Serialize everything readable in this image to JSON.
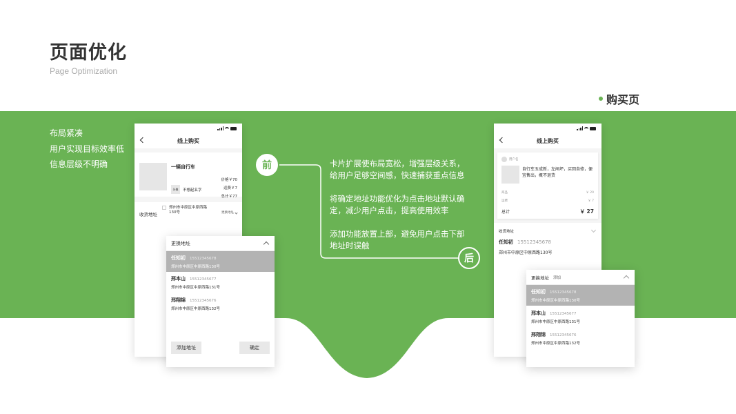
{
  "header": {
    "title": "页面优化",
    "subtitle": "Page Optimization",
    "section": "购买页"
  },
  "colors": {
    "accent": "#6ab354",
    "selected_row": "#b3b3b3",
    "button_bg": "#e8e8e8"
  },
  "problems": [
    "布局紧凑",
    "用户实现目标效率低",
    "信息层级不明确"
  ],
  "before": {
    "badge": "前",
    "nav_title": "线上购买",
    "product": {
      "name": "一辆自行车",
      "price": "价格￥70",
      "shipping": "运费￥7",
      "total": "总计￥77",
      "seller_avatar": "头像",
      "seller_name": "不想起名字"
    },
    "address_row": {
      "label": "收货地址",
      "value": "郑州市中原区中原西路130号",
      "change": "更换地址"
    },
    "popup": {
      "title": "更换地址",
      "items": [
        {
          "name": "任知初",
          "phone": "15512345678",
          "address": "郑州市中原区中原西路130号",
          "selected": true
        },
        {
          "name": "邢本山",
          "phone": "15512345677",
          "address": "郑州市中原区中原西路131号",
          "selected": false
        },
        {
          "name": "邢翔锦",
          "phone": "15512345676",
          "address": "郑州市中原区中原西路132号",
          "selected": false
        }
      ],
      "add_button": "添加地址",
      "confirm_button": "确定"
    }
  },
  "after": {
    "badge": "后",
    "nav_title": "线上购买",
    "card": {
      "username": "用户名",
      "description": "自行车五成新，左闸坏，买回自修，便宜售出，概不退货",
      "goods_label": "商品",
      "goods_value": "￥ 20",
      "shipping_label": "运费",
      "shipping_value": "￥ 7",
      "total_label": "总计",
      "total_value": "￥ 27"
    },
    "address": {
      "label": "收货地址",
      "name": "任知初",
      "phone": "15512345678",
      "value": "郑州市中原区中原西路130号"
    },
    "popup": {
      "title": "更换地址",
      "add": "添加",
      "items": [
        {
          "name": "任知初",
          "phone": "15512345678",
          "address": "郑州市中原区中原西路130号",
          "selected": true
        },
        {
          "name": "邢本山",
          "phone": "15512345677",
          "address": "郑州市中原区中原西路131号",
          "selected": false
        },
        {
          "name": "邢翔锦",
          "phone": "15512345676",
          "address": "郑州市中原区中原西路132号",
          "selected": false
        }
      ]
    }
  },
  "notes": [
    "卡片扩展使布局宽松，增强层级关系，给用户足够空间感，快速捕获重点信息",
    "将确定地址功能优化为点击地址默认确定，减少用户点击，提高使用效率",
    "添加功能放置上部，避免用户点击下部地址时误触"
  ]
}
